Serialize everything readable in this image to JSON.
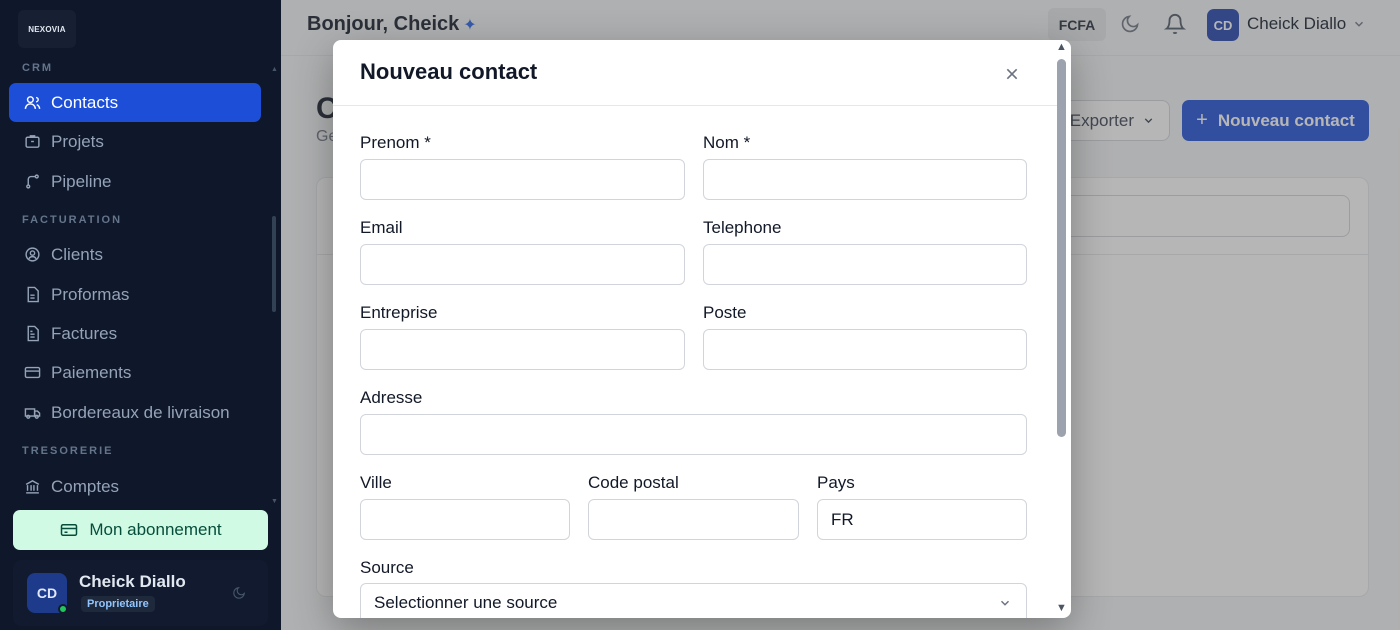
{
  "sidebar": {
    "logo": "NEXOVIA",
    "sections": [
      {
        "label": "CRM"
      },
      {
        "label": "FACTURATION"
      },
      {
        "label": "TRESORERIE"
      }
    ],
    "items": [
      {
        "label": "Contacts",
        "icon": "contacts-icon",
        "active": true
      },
      {
        "label": "Projets",
        "icon": "projects-icon"
      },
      {
        "label": "Pipeline",
        "icon": "pipeline-icon"
      },
      {
        "label": "Clients",
        "icon": "clients-icon"
      },
      {
        "label": "Proformas",
        "icon": "proformas-icon"
      },
      {
        "label": "Factures",
        "icon": "invoices-icon"
      },
      {
        "label": "Paiements",
        "icon": "payments-icon"
      },
      {
        "label": "Bordereaux de livraison",
        "icon": "delivery-icon"
      },
      {
        "label": "Comptes",
        "icon": "bank-icon"
      }
    ],
    "subscription_label": "Mon abonnement",
    "user": {
      "initials": "CD",
      "name": "Cheick Diallo",
      "role": "Proprietaire"
    }
  },
  "topbar": {
    "greeting": "Bonjour, Cheick",
    "currency": "FCFA",
    "user_initials": "CD",
    "user_name": "Cheick Diallo"
  },
  "page": {
    "title_initial": "C",
    "subtitle_initial": "Ge",
    "export_label": "Exporter",
    "new_contact_label": "Nouveau contact"
  },
  "modal": {
    "title": "Nouveau contact",
    "fields": {
      "prenom": {
        "label": "Prenom *",
        "value": ""
      },
      "nom": {
        "label": "Nom *",
        "value": ""
      },
      "email": {
        "label": "Email",
        "value": ""
      },
      "telephone": {
        "label": "Telephone",
        "value": ""
      },
      "entreprise": {
        "label": "Entreprise",
        "value": ""
      },
      "poste": {
        "label": "Poste",
        "value": ""
      },
      "adresse": {
        "label": "Adresse",
        "value": ""
      },
      "ville": {
        "label": "Ville",
        "value": ""
      },
      "code_postal": {
        "label": "Code postal",
        "value": ""
      },
      "pays": {
        "label": "Pays",
        "value": "FR"
      },
      "source": {
        "label": "Source",
        "value": "Selectionner une source"
      }
    }
  },
  "colors": {
    "sidebar_bg": "#0f172a",
    "accent": "#1d4ed8",
    "subscription_bg": "#d1fae5",
    "online": "#22c55e"
  }
}
